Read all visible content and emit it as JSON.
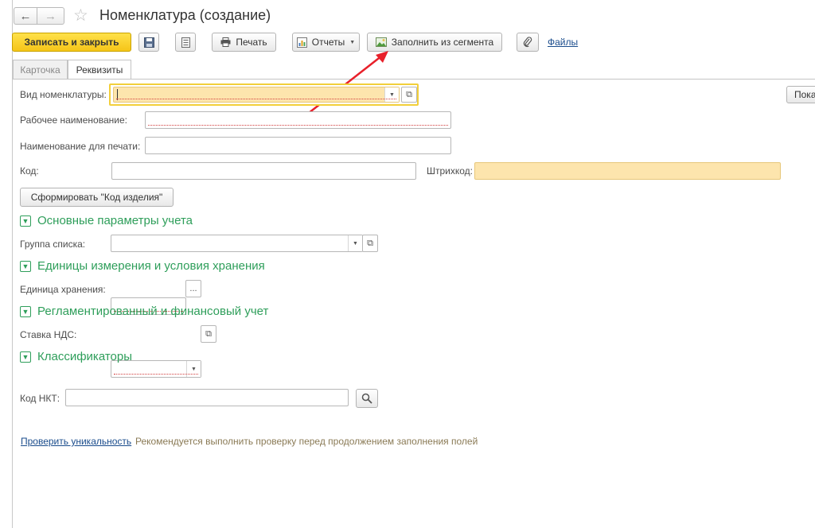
{
  "window": {
    "title": "Номенклатура (создание)"
  },
  "toolbar": {
    "save_close_label": "Записать и закрыть",
    "print_label": "Печать",
    "reports_label": "Отчеты",
    "fill_segment_label": "Заполнить из сегмента",
    "files_label": "Файлы"
  },
  "tabs": [
    {
      "label": "Карточка",
      "active": false
    },
    {
      "label": "Реквизиты",
      "active": true
    }
  ],
  "form": {
    "kind_label": "Вид номенклатуры:",
    "kind_value": "",
    "working_name_label": "Рабочее наименование:",
    "working_name_value": "",
    "print_name_label": "Наименование для печати:",
    "print_name_value": "",
    "code_label": "Код:",
    "code_value": "",
    "barcode_label": "Штрихкод:",
    "barcode_value": "",
    "generate_code_button": "Сформировать \"Код изделия\"",
    "show_button_partial": "Пока"
  },
  "sections": {
    "accounting": "Основные параметры учета",
    "units": "Единицы измерения и условия хранения",
    "regulated": "Регламентированный и финансовый учет",
    "classifiers": "Классификаторы"
  },
  "fields": {
    "list_group_label": "Группа списка:",
    "storage_unit_label": "Единица хранения:",
    "storage_unit_select": "...",
    "vat_rate_label": "Ставка НДС:",
    "nkt_code_label": "Код НКТ:"
  },
  "footer": {
    "check_link": "Проверить уникальность",
    "hint": "Рекомендуется выполнить проверку перед продолжением заполнения полей"
  },
  "annotation": {
    "arrow_color": "#e8202a"
  },
  "colors": {
    "primary_button": "#f5c518",
    "section_header": "#2e9e5a",
    "required_field_bg": "#fde5ad",
    "link": "#1a4c8c"
  }
}
